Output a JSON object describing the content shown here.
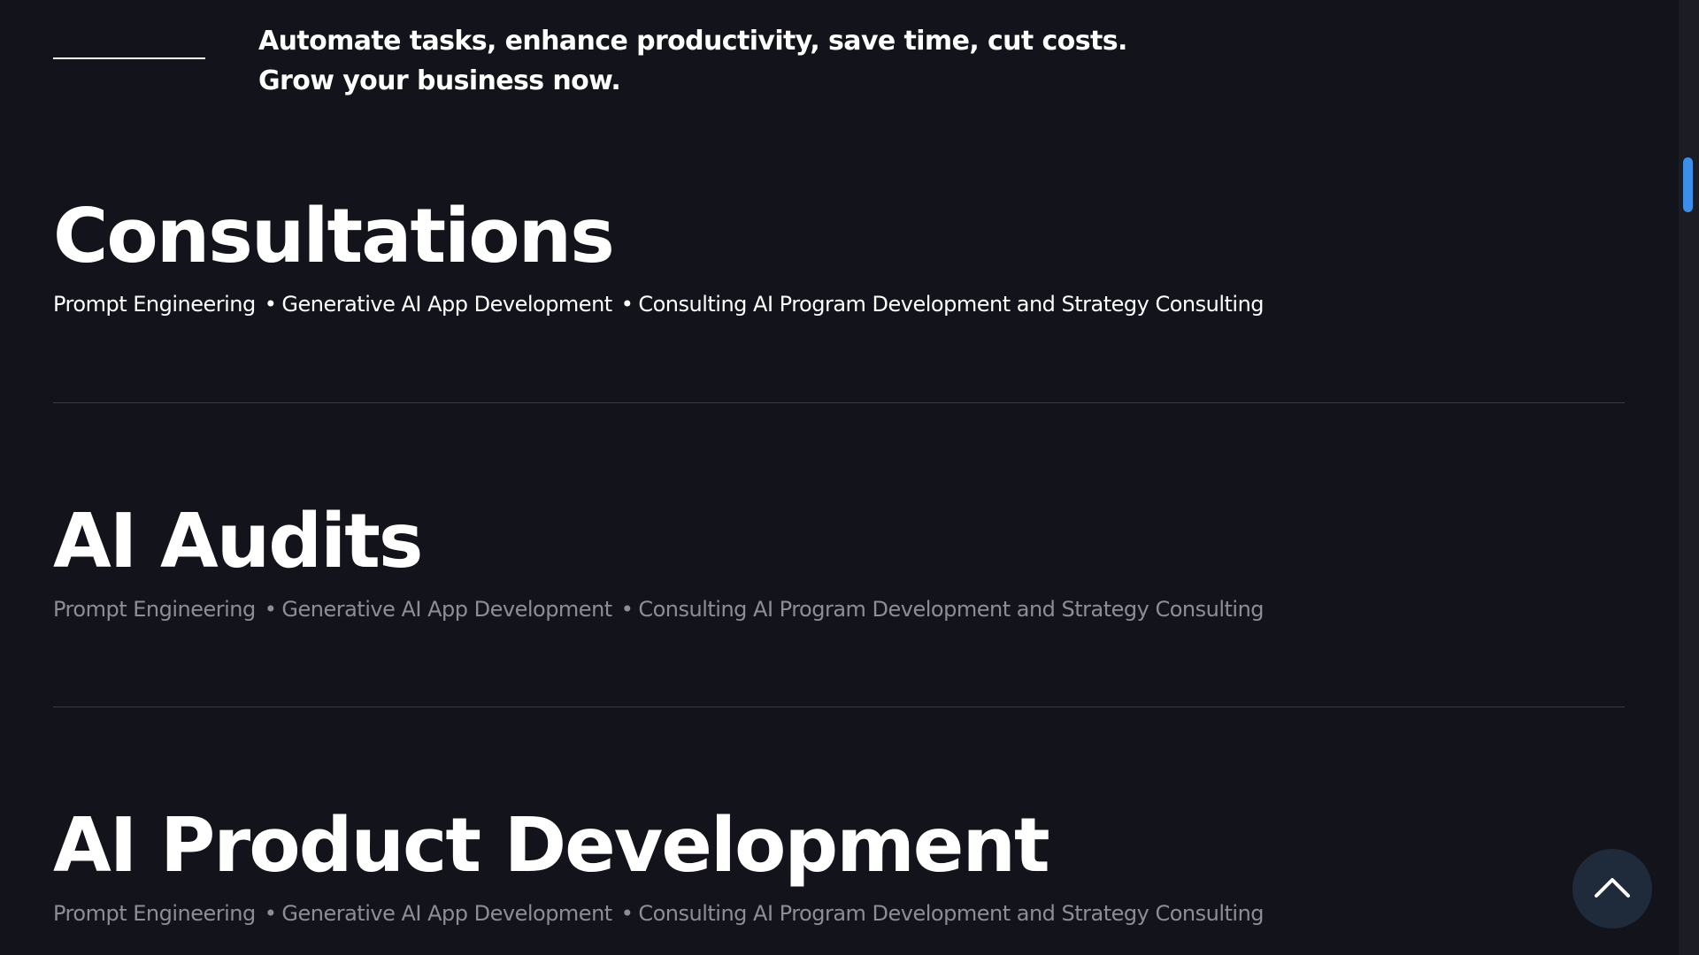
{
  "intro": {
    "line1": "Automate tasks, enhance productivity, save time, cut costs.",
    "line2": "Grow your business now."
  },
  "services": [
    {
      "title": "Consultations",
      "tags": [
        "Prompt Engineering",
        "Generative AI App Development",
        "Consulting AI Program Development and Strategy Consulting"
      ]
    },
    {
      "title": "AI Audits",
      "tags": [
        "Prompt Engineering",
        "Generative AI App Development",
        "Consulting AI Program Development and Strategy Consulting"
      ]
    },
    {
      "title": "AI Product Development",
      "tags": [
        "Prompt Engineering",
        "Generative AI App Development",
        "Consulting AI Program Development and Strategy Consulting"
      ]
    }
  ],
  "tag_separator": "•",
  "icons": {
    "back_to_top": "chevron-up-icon"
  },
  "colors": {
    "background": "#13141b",
    "text_primary": "#ffffff",
    "text_muted": "#8c8e96",
    "divider": "#3a3c45",
    "scrollbar_thumb": "#3b8fe8",
    "back_to_top_bg": "#1f2a3a"
  }
}
